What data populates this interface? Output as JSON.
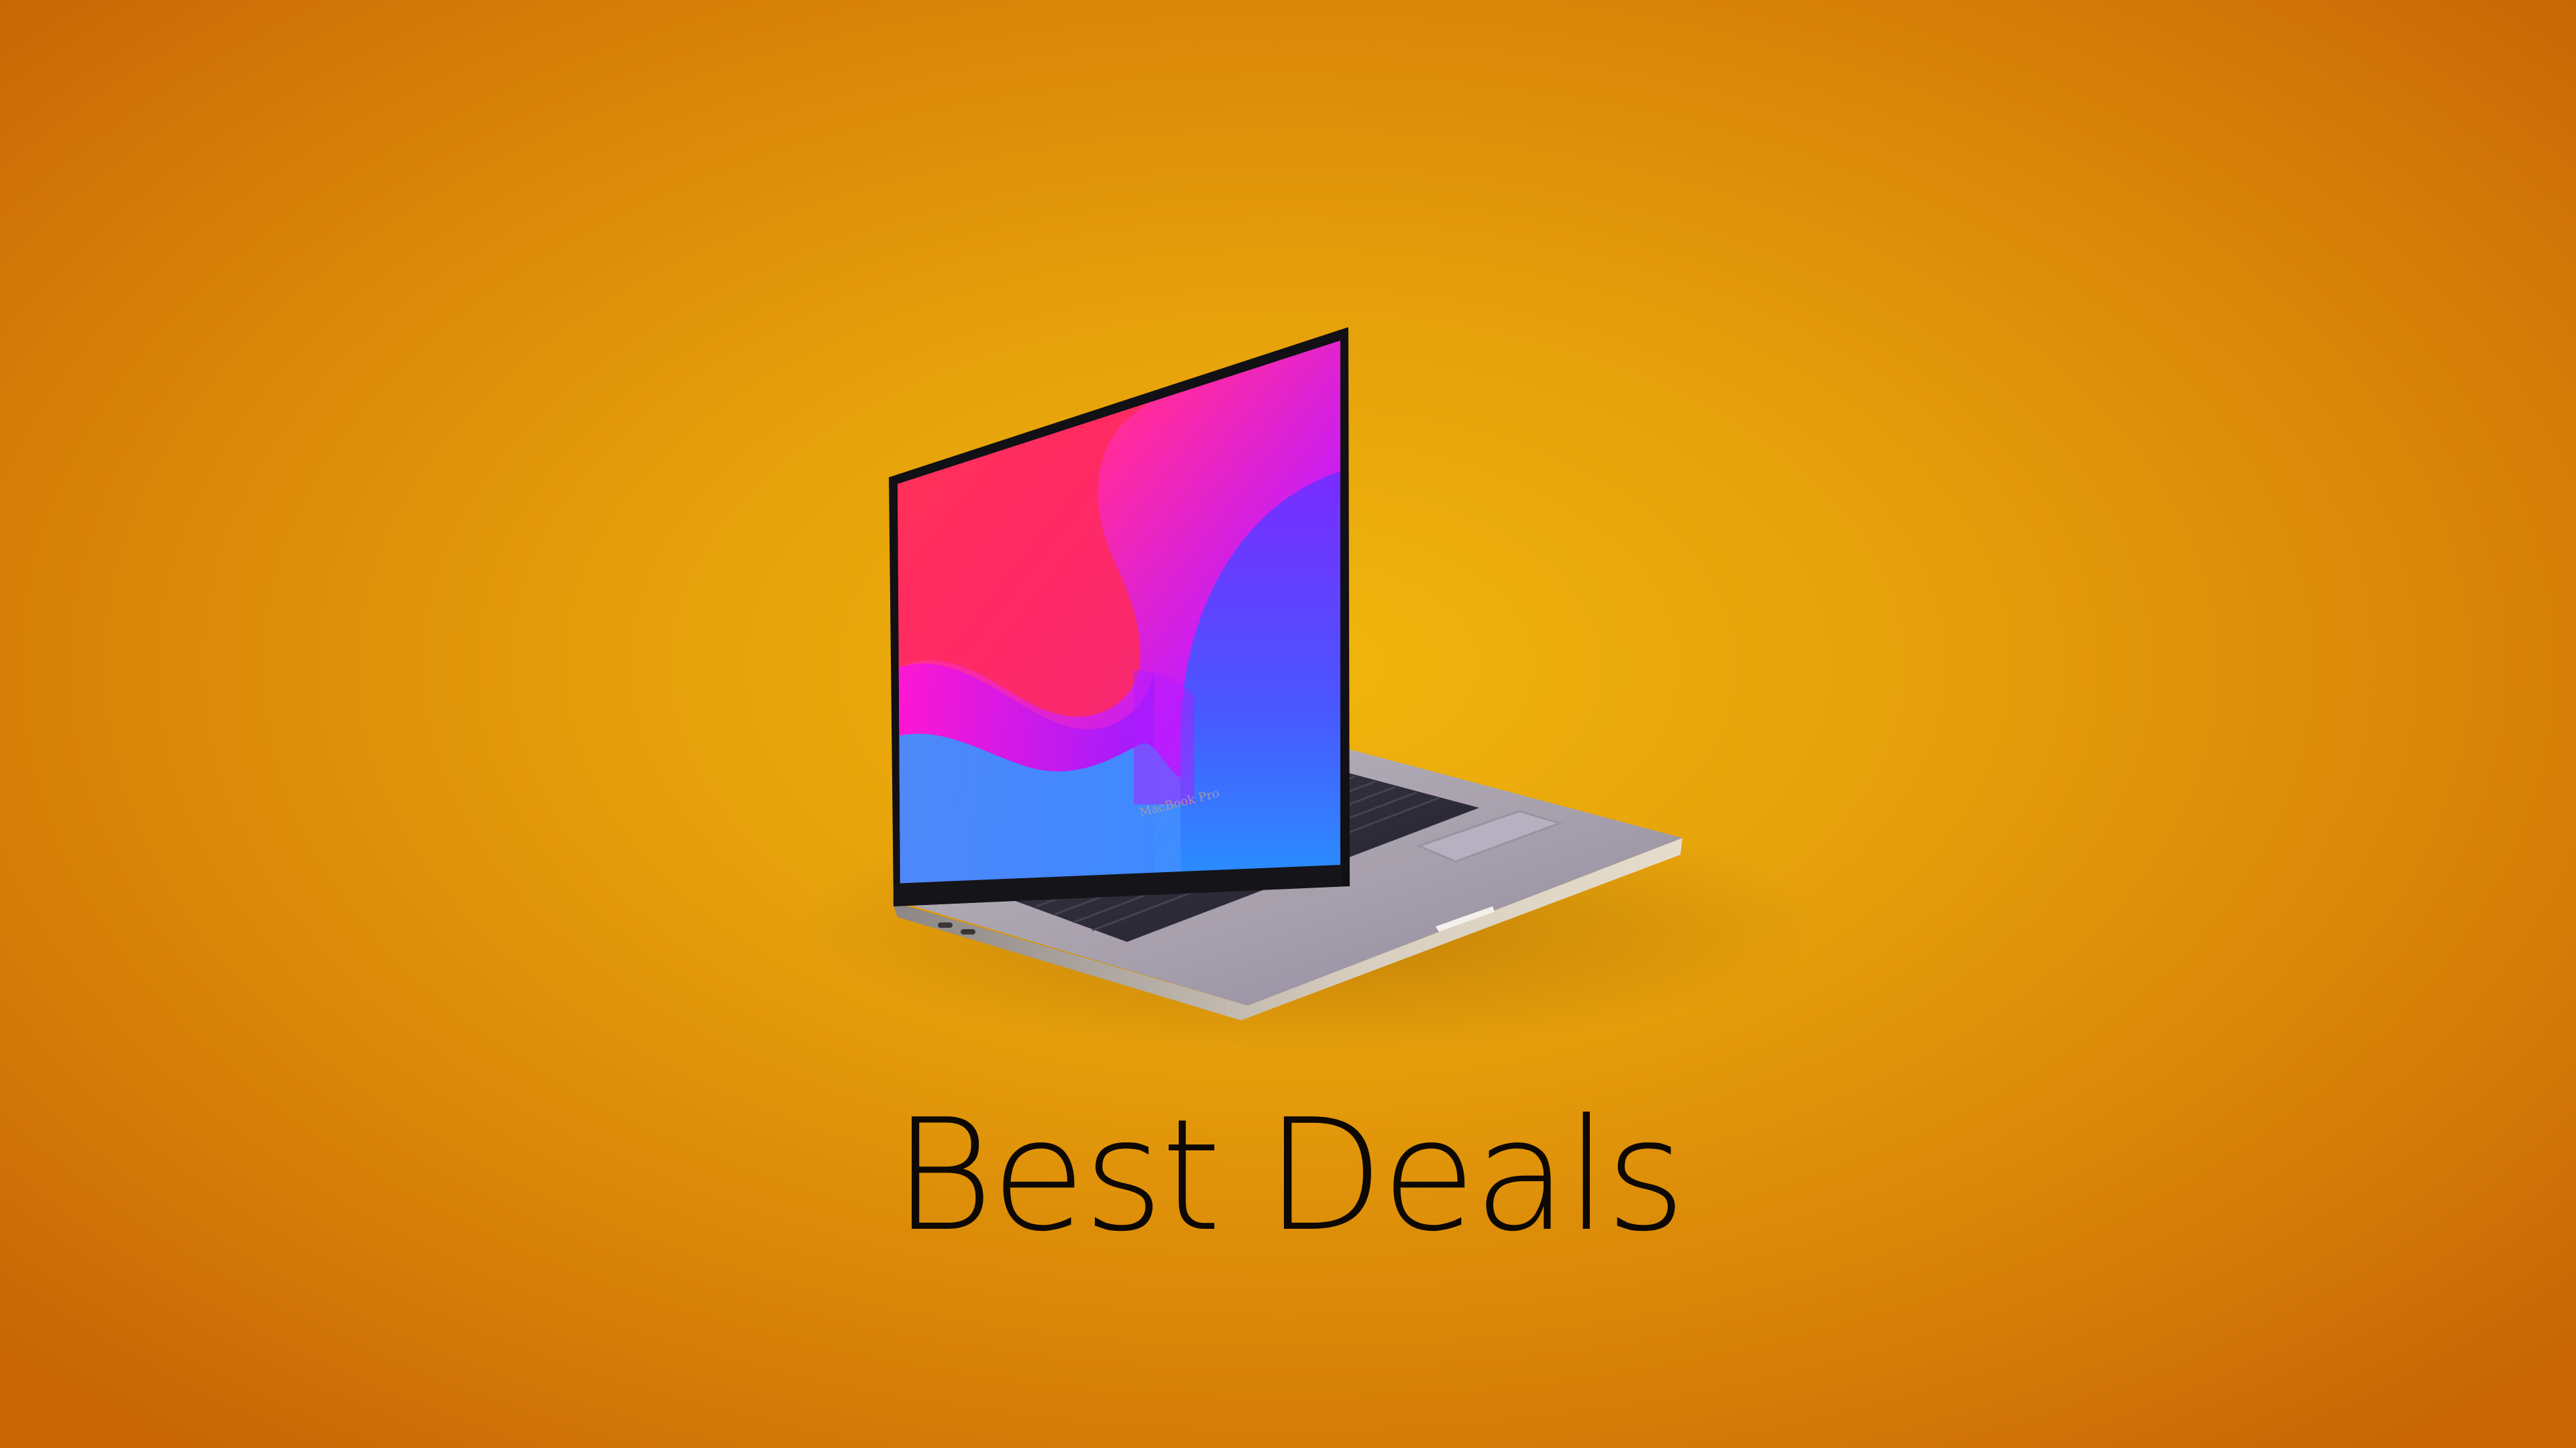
{
  "headline": "Best Deals",
  "laptop_brand_label": "MacBook Pro",
  "colors": {
    "background_center": "#f0b60c",
    "background_edge": "#c86606",
    "headline_text": "#0d0804",
    "laptop_body": "#a9a3ad",
    "screen_wallpaper": [
      "#ff5a1f",
      "#ff1ec8",
      "#8a2bff",
      "#2a8bff"
    ]
  },
  "icons": [
    "laptop-illustration"
  ]
}
